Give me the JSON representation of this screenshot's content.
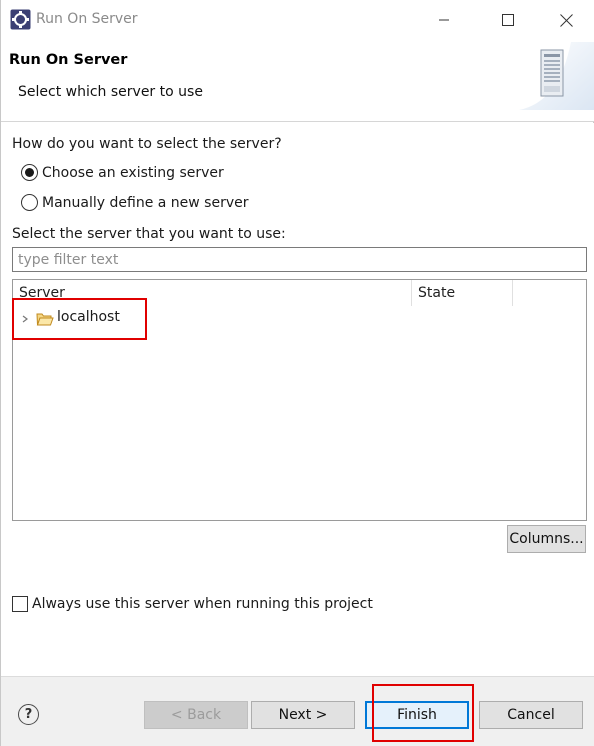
{
  "window": {
    "title": "Run On Server",
    "icon": "eclipse-gear-icon"
  },
  "banner": {
    "title": "Run On Server",
    "subtitle": "Select which server to use",
    "art": "server-tower-icon"
  },
  "selection": {
    "question": "How do you want to select the server?",
    "options": [
      {
        "label": "Choose an existing server",
        "selected": true
      },
      {
        "label": "Manually define a new server",
        "selected": false
      }
    ],
    "server_prompt": "Select the server that you want to use:",
    "filter_placeholder": "type filter text",
    "filter_value": ""
  },
  "table": {
    "columns": [
      "Server",
      "State"
    ],
    "rows": [
      {
        "server": "localhost",
        "state": "",
        "icon": "folder-open-icon",
        "expanded": false
      }
    ],
    "columns_button": "Columns..."
  },
  "always_use": {
    "label": "Always use this server when running this project",
    "checked": false
  },
  "footer": {
    "help_icon": "help-icon",
    "back": "< Back",
    "next": "Next >",
    "finish": "Finish",
    "cancel": "Cancel"
  },
  "colors": {
    "annotation_red": "#e00000",
    "default_button_border": "#0078d7"
  }
}
